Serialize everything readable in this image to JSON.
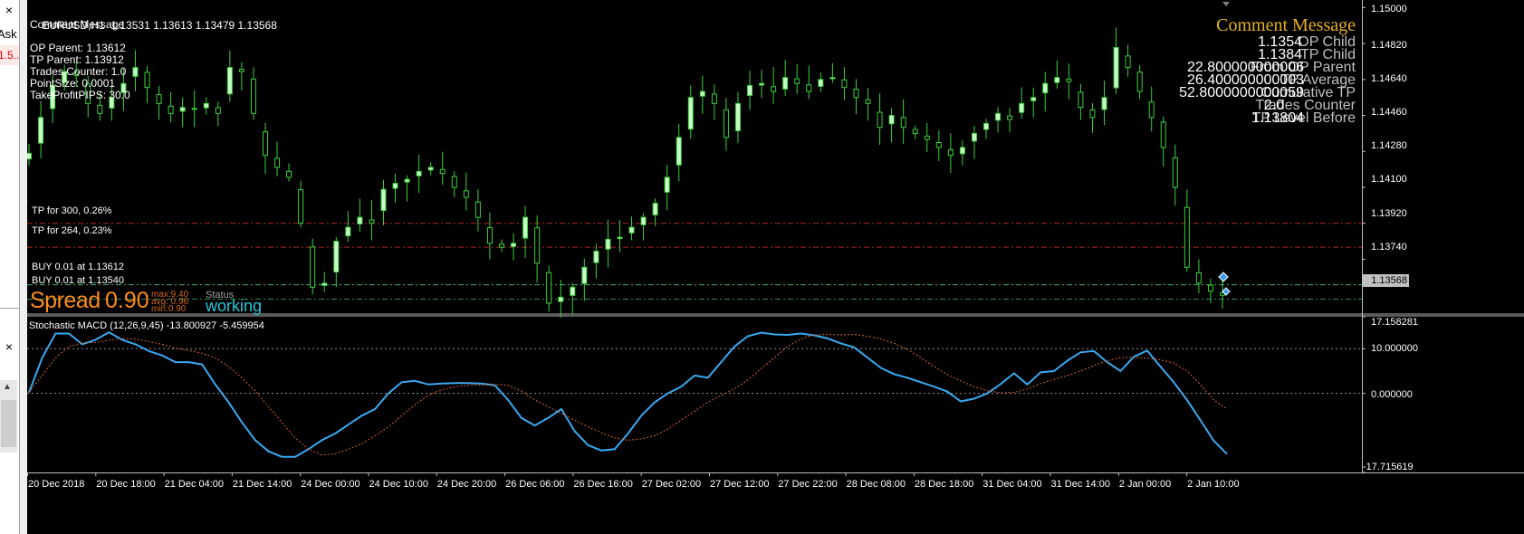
{
  "chart_data": [
    {
      "type": "candlestick",
      "symbol": "EURUSD,H1",
      "ohlc_header": "1.13531 1.13613 1.13479 1.13568",
      "comment": "Comment Message",
      "ylim": [
        1.1347,
        1.1502
      ],
      "y_ticks": [
        "1.15000",
        "1.14820",
        "1.14640",
        "1.14460",
        "1.14280",
        "1.14100",
        "1.13920",
        "1.13740"
      ],
      "current_price_tag": "1.13568",
      "levels": [
        {
          "label": "TP for 300, 0.26%",
          "price": 1.1392,
          "color": "#b22222"
        },
        {
          "label": "TP for 264, 0.23%",
          "price": 1.138,
          "color": "#b22222"
        },
        {
          "label": "BUY 0.01 at 1.13612",
          "price": 1.13612,
          "color": "#3cb371"
        },
        {
          "label": "BUY 0.01 at 1.13540",
          "price": 1.1354,
          "color": "#2e8b57"
        }
      ],
      "trend_closes": [
        1.1427,
        1.1445,
        1.1461,
        1.1468,
        1.1466,
        1.1452,
        1.1447,
        1.1455,
        1.1462,
        1.147,
        1.146,
        1.1452,
        1.1447,
        1.145,
        1.1449,
        1.1452,
        1.1447,
        1.147,
        1.1468,
        1.1447,
        1.1426,
        1.142,
        1.1415,
        1.1392,
        1.136,
        1.1362,
        1.1383,
        1.139,
        1.1395,
        1.1392,
        1.1409,
        1.1412,
        1.1414,
        1.1418,
        1.142,
        1.1417,
        1.141,
        1.1405,
        1.1395,
        1.1382,
        1.138,
        1.1382,
        1.1395,
        1.1372,
        1.1352,
        1.1355,
        1.136,
        1.137,
        1.1378,
        1.1384,
        1.1385,
        1.139,
        1.1395,
        1.1402,
        1.1415,
        1.1435,
        1.1455,
        1.1458,
        1.1452,
        1.1435,
        1.1452,
        1.1461,
        1.1462,
        1.1458,
        1.1465,
        1.1462,
        1.1458,
        1.1464,
        1.1465,
        1.146,
        1.1455,
        1.1452,
        1.144,
        1.1446,
        1.144,
        1.1437,
        1.1434,
        1.143,
        1.1426,
        1.143,
        1.1437,
        1.1442,
        1.1447,
        1.1444,
        1.1452,
        1.1455,
        1.1462,
        1.1465,
        1.1463,
        1.145,
        1.1445,
        1.1455,
        1.148,
        1.147,
        1.1458,
        1.1445,
        1.143,
        1.141,
        1.137,
        1.1362,
        1.1358,
        1.1356
      ]
    },
    {
      "type": "line",
      "title": "Stochastic MACD (12,26,9,45) -13.800927 -5.459954",
      "ylim": [
        -17.715619,
        17.158281
      ],
      "y_ticks": [
        17.158281,
        10.0,
        0.0,
        -17.715619
      ],
      "y_tick_labels": [
        "17.158281",
        "10.000000",
        "0.000000",
        "-17.715619"
      ],
      "levels": [
        10,
        0
      ],
      "series": [
        {
          "color": "#3aa8f0",
          "values": [
            0.2,
            8,
            13.4,
            13.4,
            11,
            12,
            13.7,
            12,
            11,
            9.5,
            8.5,
            7,
            7,
            6.5,
            2,
            -2,
            -6.5,
            -10.5,
            -13,
            -14.2,
            -14.2,
            -12.5,
            -10.5,
            -9,
            -7,
            -5,
            -3.5,
            0,
            2.5,
            2.8,
            2,
            2.2,
            2.3,
            2.3,
            2.2,
            1.8,
            -1.5,
            -5.5,
            -7.2,
            -5.5,
            -3.5,
            -8.5,
            -11.6,
            -12.8,
            -12.5,
            -9,
            -5,
            -2,
            0,
            1.5,
            4,
            3.5,
            7,
            10.5,
            12.8,
            13.6,
            13.2,
            13.1,
            13.4,
            13,
            12.3,
            11.2,
            10.3,
            8,
            5.7,
            4.3,
            3.5,
            2.5,
            1.5,
            0.4,
            -1.8,
            -1.2,
            0,
            2.1,
            4.5,
            2,
            4.7,
            5,
            7.3,
            9.2,
            9.5,
            7,
            5,
            8.2,
            9.6,
            6,
            2.5,
            -1.5,
            -6,
            -10.6,
            -13.6
          ]
        },
        {
          "color": "#d8643a",
          "style": "dotted",
          "values": [
            0.2,
            4,
            8,
            10.5,
            11.3,
            11.4,
            11.9,
            12.3,
            12.2,
            11.6,
            11,
            10.1,
            9.6,
            9,
            8,
            6,
            3.5,
            0.5,
            -3,
            -6.5,
            -10,
            -12.5,
            -13.8,
            -13.5,
            -12.5,
            -11.3,
            -9.5,
            -7.5,
            -5,
            -2.5,
            -0.4,
            0.8,
            1.5,
            1.8,
            1.9,
            2.0,
            1.8,
            0.5,
            -1.5,
            -3,
            -4.5,
            -6,
            -7.5,
            -8.8,
            -10,
            -10.5,
            -10.2,
            -9.5,
            -8,
            -6,
            -4,
            -2,
            -0.5,
            1,
            3,
            5.5,
            8,
            10.5,
            12.2,
            13.1,
            13.2,
            13.1,
            13.2,
            12.8,
            12.2,
            11.2,
            9.8,
            8,
            6,
            4.2,
            2.8,
            1.5,
            0.6,
            0.1,
            0.2,
            1,
            2.2,
            3.1,
            4,
            5,
            6.2,
            7.3,
            8,
            8.1,
            7.9,
            7.5,
            6.8,
            5,
            2,
            -1.5,
            -3.5
          ]
        }
      ]
    }
  ],
  "info_lines": [
    "OP Parent: 1.13612",
    "TP Parent: 1.13912",
    "Trades Counter: 1.0",
    "PointSize: 0.0001",
    "TakeProfitPIPS: 30.0"
  ],
  "right_panel": {
    "title": "Comment Message",
    "values": [
      "1.1354",
      "1.1384",
      "22.800000000006",
      "26.400000000003",
      "52.8000000000059",
      "2.0",
      "1.13804"
    ],
    "labels": [
      "OP Child",
      "TP Child",
      "From OP Parent",
      "TP Average",
      "Cumulative TP",
      "Trades Counter",
      "TP Level Before"
    ]
  },
  "spread": {
    "label": "Spread",
    "value": "0.90",
    "max": "max:9.40",
    "avg": "avg: 0.96",
    "min": "min:0.90",
    "status_label": "Status",
    "status_value": "working"
  },
  "x_ticks": [
    "20 Dec 2018",
    "20 Dec 18:00",
    "21 Dec 04:00",
    "21 Dec 14:00",
    "24 Dec 00:00",
    "24 Dec 10:00",
    "24 Dec 20:00",
    "26 Dec 06:00",
    "26 Dec 16:00",
    "27 Dec 02:00",
    "27 Dec 12:00",
    "27 Dec 22:00",
    "28 Dec 08:00",
    "28 Dec 18:00",
    "31 Dec 04:00",
    "31 Dec 14:00",
    "2 Jan 00:00",
    "2 Jan 10:00"
  ],
  "left_panel": {
    "close_glyph": "×",
    "ask_text": "Ask",
    "red_text": "1.5..."
  },
  "colors": {
    "background": "#000000",
    "bull": "#c8ffc8",
    "grid": "#808080",
    "label": "#ffffff"
  }
}
